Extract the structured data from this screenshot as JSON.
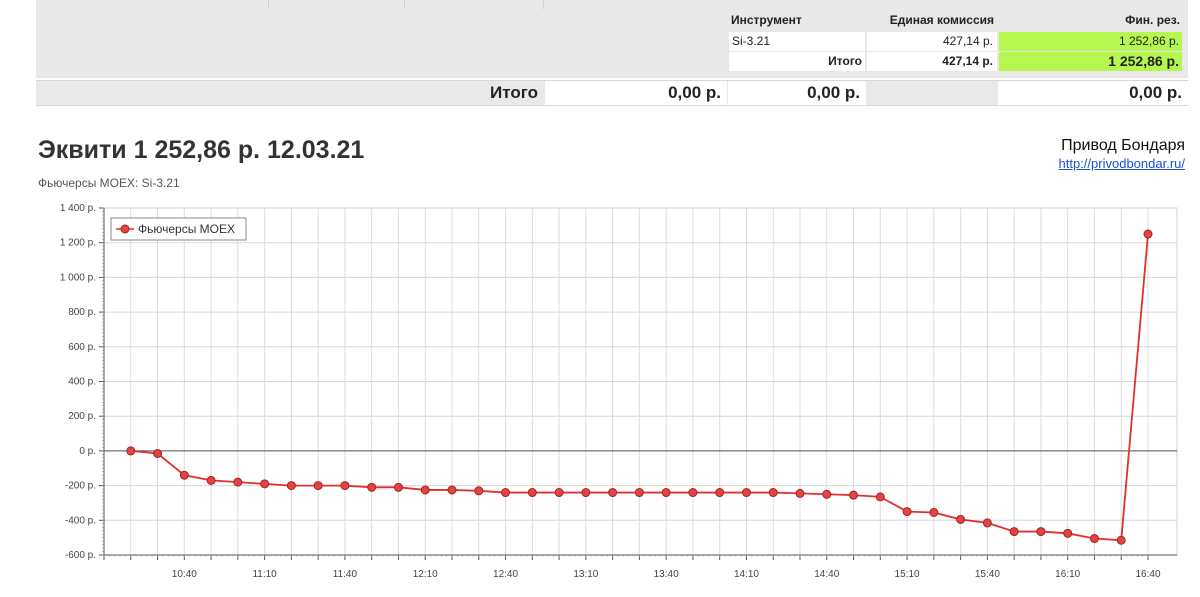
{
  "table": {
    "headers": {
      "instrument": "Инструмент",
      "commission": "Единая комиссия",
      "fin_result": "Фин. рез."
    },
    "rows": [
      {
        "instrument": "Si-3.21",
        "commission": "427,14 р.",
        "fin_result": "1 252,86 р."
      }
    ],
    "subtotal": {
      "label": "Итого",
      "commission": "427,14 р.",
      "fin_result": "1 252,86 р."
    },
    "colors": {
      "positive_result": "#b5f74e",
      "panel": "#e8e8e8"
    }
  },
  "totals": {
    "label": "Итого",
    "values": [
      "0,00 р.",
      "0,00 р.",
      "0,00 р."
    ]
  },
  "header": {
    "title": "Эквити 1 252,86 р. 12.03.21",
    "subtitle": "Фьючерсы MOEX: Si-3.21",
    "brand_name": "Привод Бондаря",
    "brand_link": "http://privodbondar.ru/"
  },
  "chart_data": {
    "type": "line",
    "title": "",
    "xlabel": "",
    "ylabel": "",
    "color": "#e03030",
    "legend_position": "top-left",
    "grid": true,
    "ylim": [
      -600,
      1400
    ],
    "yticks": [
      -600,
      -400,
      -200,
      0,
      200,
      400,
      600,
      800,
      1000,
      1200,
      1400
    ],
    "ytick_labels": [
      "-600 р.",
      "-400 р.",
      "-200 р.",
      "0 р.",
      "200 р.",
      "400 р.",
      "600 р.",
      "800 р.",
      "1 000 р.",
      "1 200 р.",
      "1 400 р."
    ],
    "xlim": [
      "10:10",
      "16:40"
    ],
    "xtick_labels": [
      "10:40",
      "11:10",
      "11:40",
      "12:10",
      "12:40",
      "13:10",
      "13:40",
      "14:10",
      "14:40",
      "15:10",
      "15:40",
      "16:10",
      "16:40"
    ],
    "series": [
      {
        "name": "Фьючерсы MOEX",
        "x": [
          "10:20",
          "10:30",
          "10:40",
          "10:50",
          "11:00",
          "11:10",
          "11:20",
          "11:30",
          "11:40",
          "11:50",
          "12:00",
          "12:10",
          "12:20",
          "12:30",
          "12:40",
          "12:50",
          "13:00",
          "13:10",
          "13:20",
          "13:30",
          "13:40",
          "13:50",
          "14:00",
          "14:10",
          "14:20",
          "14:30",
          "14:40",
          "14:50",
          "15:00",
          "15:10",
          "15:20",
          "15:30",
          "15:40",
          "15:50",
          "16:00",
          "16:10",
          "16:20",
          "16:30",
          "16:40"
        ],
        "values": [
          0,
          -15,
          -140,
          -170,
          -180,
          -190,
          -200,
          -200,
          -200,
          -210,
          -210,
          -225,
          -225,
          -230,
          -240,
          -240,
          -240,
          -240,
          -240,
          -240,
          -240,
          -240,
          -240,
          -240,
          -240,
          -245,
          -250,
          -255,
          -265,
          -350,
          -355,
          -395,
          -415,
          -465,
          -465,
          -475,
          -505,
          -515,
          1250
        ]
      }
    ]
  }
}
